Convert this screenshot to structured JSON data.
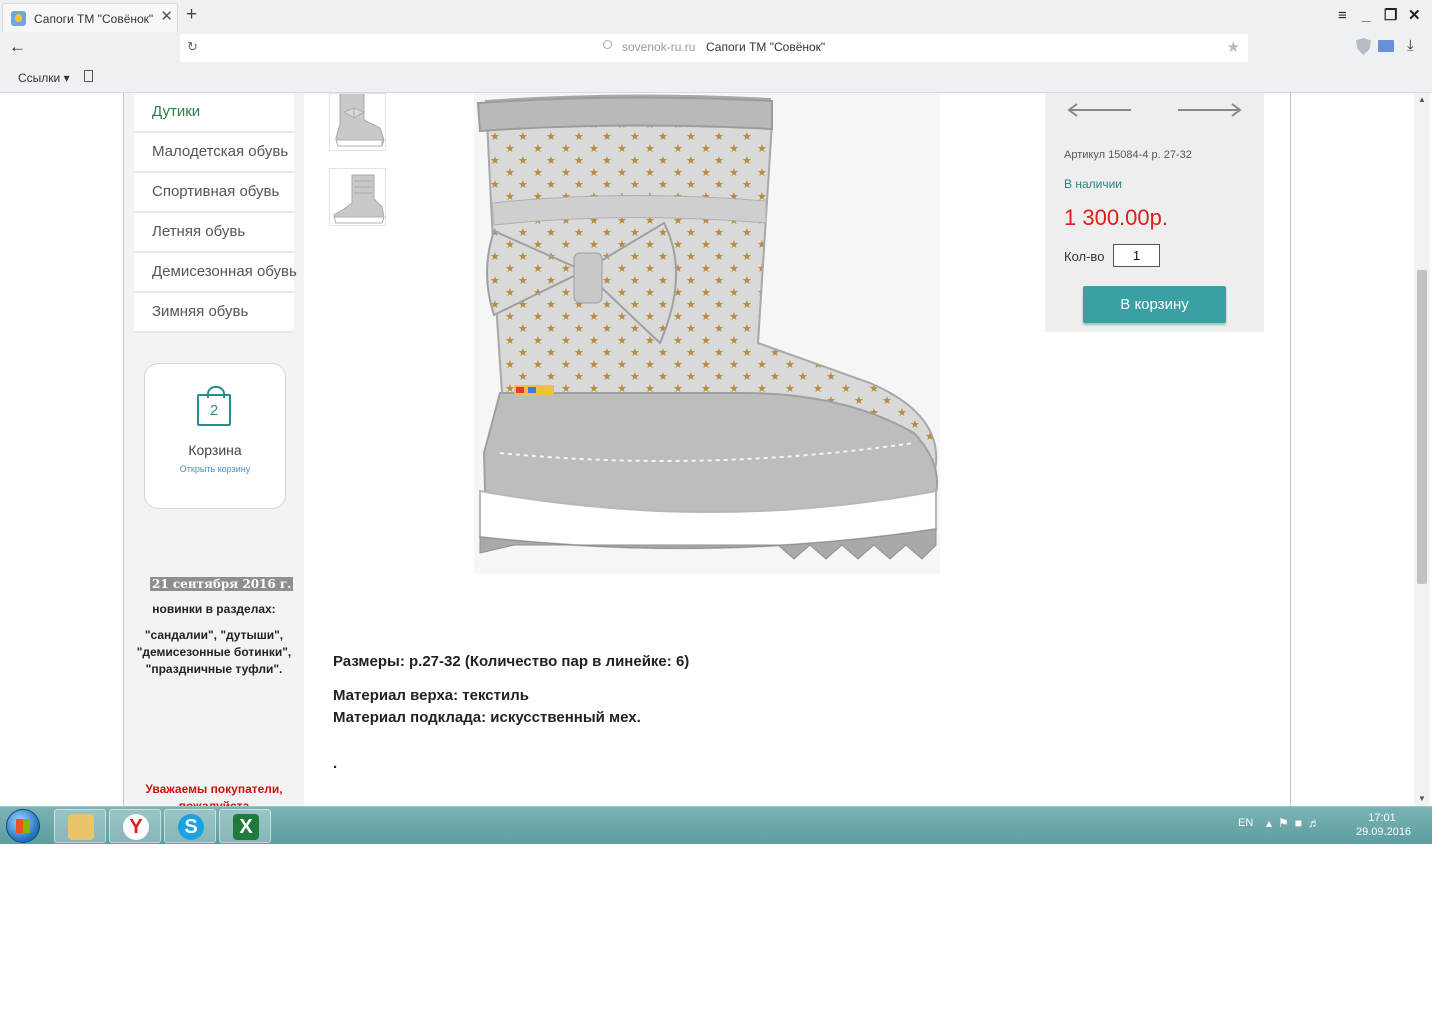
{
  "browser": {
    "tab_title": "Сапоги ТМ \"Совёнок\"",
    "tab_close": "✕",
    "new_tab": "+",
    "url_domain": "sovenok-ru.ru",
    "url_title": "Сапоги ТМ \"Совёнок\"",
    "bookmarks_label": "Ссылки ▾",
    "window_controls": [
      "≡",
      "_",
      "❐",
      "✕"
    ]
  },
  "sidebar": {
    "menu": [
      {
        "label": "Дутики",
        "active": true
      },
      {
        "label": "Малодетская обувь"
      },
      {
        "label": "Спортивная обувь"
      },
      {
        "label": "Летняя обувь"
      },
      {
        "label": "Демисезонная обувь"
      },
      {
        "label": "Зимняя обувь"
      }
    ],
    "cart": {
      "count": "2",
      "title": "Корзина",
      "link": "Открыть корзину"
    },
    "news": {
      "date": "21 сентября 2016 г.",
      "text": "новинки в разделах:",
      "quotes": "\"сандалии\", \"дутыши\", \"демисезонные ботинки\", \"праздничные туфли\"."
    },
    "warning": "Уважаемы покупатели, пожалуйста"
  },
  "product": {
    "sku": "Артикул 15084-4 р. 27-32",
    "stock": "В наличии",
    "price": "1 300.00р.",
    "qty_label": "Кол-во",
    "qty_value": "1",
    "add_to_cart": "В корзину",
    "sizes": "Размеры: р.27-32 (Количество пар в линейке: 6)",
    "material_top": "Материал верха: текстиль",
    "material_lining": "Материал подклада: искусственный мех.",
    "dot": "."
  },
  "taskbar": {
    "apps": [
      "explorer-icon",
      "yandex-browser-icon",
      "skype-icon",
      "excel-icon"
    ],
    "lang": "EN",
    "time": "17:01",
    "date": "29.09.2016"
  },
  "colors": {
    "accent": "#3aa0a4",
    "price": "#e21b1b",
    "stock": "#2a7f7f",
    "active_menu": "#2d7d45",
    "warning": "#d01010"
  }
}
